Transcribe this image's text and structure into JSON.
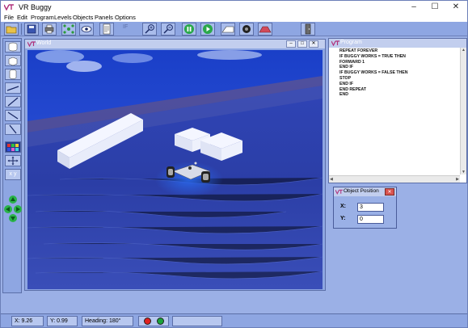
{
  "app": {
    "title": "VR Buggy",
    "window_controls": [
      "–",
      "☐",
      "✕"
    ]
  },
  "menu": [
    "File",
    "Edit",
    "Program",
    "Levels",
    "Objects",
    "Panels",
    "Options"
  ],
  "toolbar": {
    "if_label": "IF"
  },
  "world": {
    "title": "World",
    "buttons": [
      "–",
      "□",
      "✕"
    ]
  },
  "program": {
    "title": "Program",
    "lines": [
      "REPEAT FOREVER",
      "IF BUGGY WORKS = TRUE THEN",
      "FORWARD 1",
      "END IF",
      "IF BUGGY WORKS = FALSE THEN",
      "STOP",
      "END IF",
      "END REPEAT",
      "END"
    ]
  },
  "object_position": {
    "title": "Object Position",
    "x_label": "X:",
    "x_value": "3",
    "y_label": "Y:",
    "y_value": "0"
  },
  "palette": {
    "xy_label": "x y"
  },
  "status": {
    "x": "X: 9.26",
    "y": "Y: 0.99",
    "heading": "Heading: 180°",
    "message": ""
  },
  "colors": {
    "accent": "#8ea6e2",
    "water": "#2a3fae",
    "status_red": "#e02020",
    "status_green": "#1aa33a"
  }
}
